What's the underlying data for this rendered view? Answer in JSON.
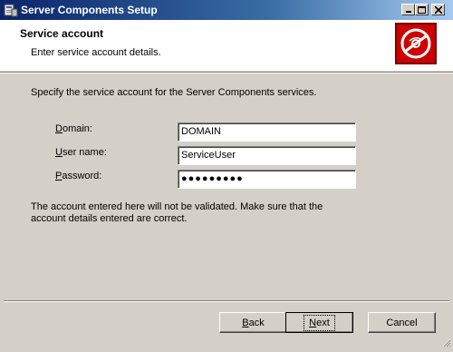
{
  "window": {
    "title": "Server Components Setup"
  },
  "header": {
    "title": "Service account",
    "subtitle": "Enter service account details."
  },
  "main": {
    "intro": "Specify the service account for the Server Components services.",
    "fields": {
      "domain": {
        "label_mn": "D",
        "label_rest": "omain:",
        "value": "DOMAIN"
      },
      "username": {
        "label_mn": "U",
        "label_rest": "ser name:",
        "value": "ServiceUser"
      },
      "password": {
        "label_mn": "P",
        "label_rest": "assword:",
        "value": "●●●●●●●●●"
      }
    },
    "note": "The account entered here will not be validated. Make sure that the account details entered are correct."
  },
  "buttons": {
    "back_mn": "B",
    "back_rest": "ack",
    "next_mn": "N",
    "next_rest": "ext",
    "cancel": "Cancel"
  },
  "icons": {
    "app": "setup-icon",
    "header_logo": "disabled-disc-icon",
    "minimize": "minimize-icon",
    "maximize": "maximize-icon",
    "close": "close-icon",
    "resize": "resize-grip-icon"
  },
  "colors": {
    "titlebar_start": "#0a246a",
    "titlebar_end": "#a6caf0",
    "logo_red": "#cc0000",
    "face": "#d4d0c8"
  }
}
